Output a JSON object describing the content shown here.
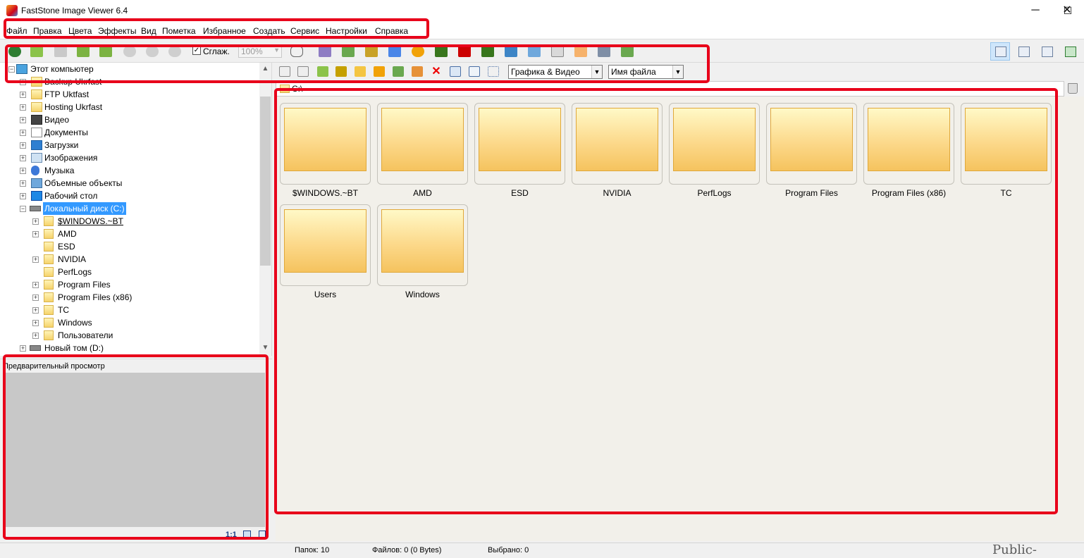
{
  "window": {
    "title": "FastStone Image Viewer 6.4",
    "minimize": "─",
    "maximize": "☐",
    "close": "✕"
  },
  "menu": [
    "Файл",
    "Правка",
    "Цвета",
    "Эффекты",
    "Вид",
    "Пометка",
    "Избранное",
    "Создать",
    "Сервис",
    "Настройки",
    "Справка"
  ],
  "toolbar": {
    "smooth_label": "Сглаж.",
    "smooth_checked": true,
    "zoom_value": "100%"
  },
  "tree": {
    "root": "Этот компьютер",
    "items": [
      "Backup Ukrfast",
      "FTP Uktfast",
      "Hosting Ukrfast",
      "Видео",
      "Документы",
      "Загрузки",
      "Изображения",
      "Музыка",
      "Объемные объекты",
      "Рабочий стол"
    ],
    "selected_drive": "Локальный диск (C:)",
    "drive_children": [
      "$WINDOWS.~BT",
      "AMD",
      "ESD",
      "NVIDIA",
      "PerfLogs",
      "Program Files",
      "Program Files (x86)",
      "TC",
      "Windows",
      "Пользователи"
    ],
    "other_drive": "Новый том (D:)"
  },
  "preview": {
    "title": "Предварительный просмотр",
    "ratio": "1:1"
  },
  "nav": {
    "filter_value": "Графика & Видео",
    "sort_value": "Имя файла"
  },
  "path": "C:\\",
  "folders": [
    "$WINDOWS.~BT",
    "AMD",
    "ESD",
    "NVIDIA",
    "PerfLogs",
    "Program Files",
    "Program Files (x86)",
    "TC",
    "Users",
    "Windows"
  ],
  "status": {
    "folders": "Папок: 10",
    "files": "Файлов: 0 (0 Bytes)",
    "selected": "Выбрано: 0"
  },
  "watermark": "Public-PC.com",
  "colors": {
    "highlight": "#e8001a",
    "selection": "#3399ff",
    "folder": "#f6d36b"
  }
}
